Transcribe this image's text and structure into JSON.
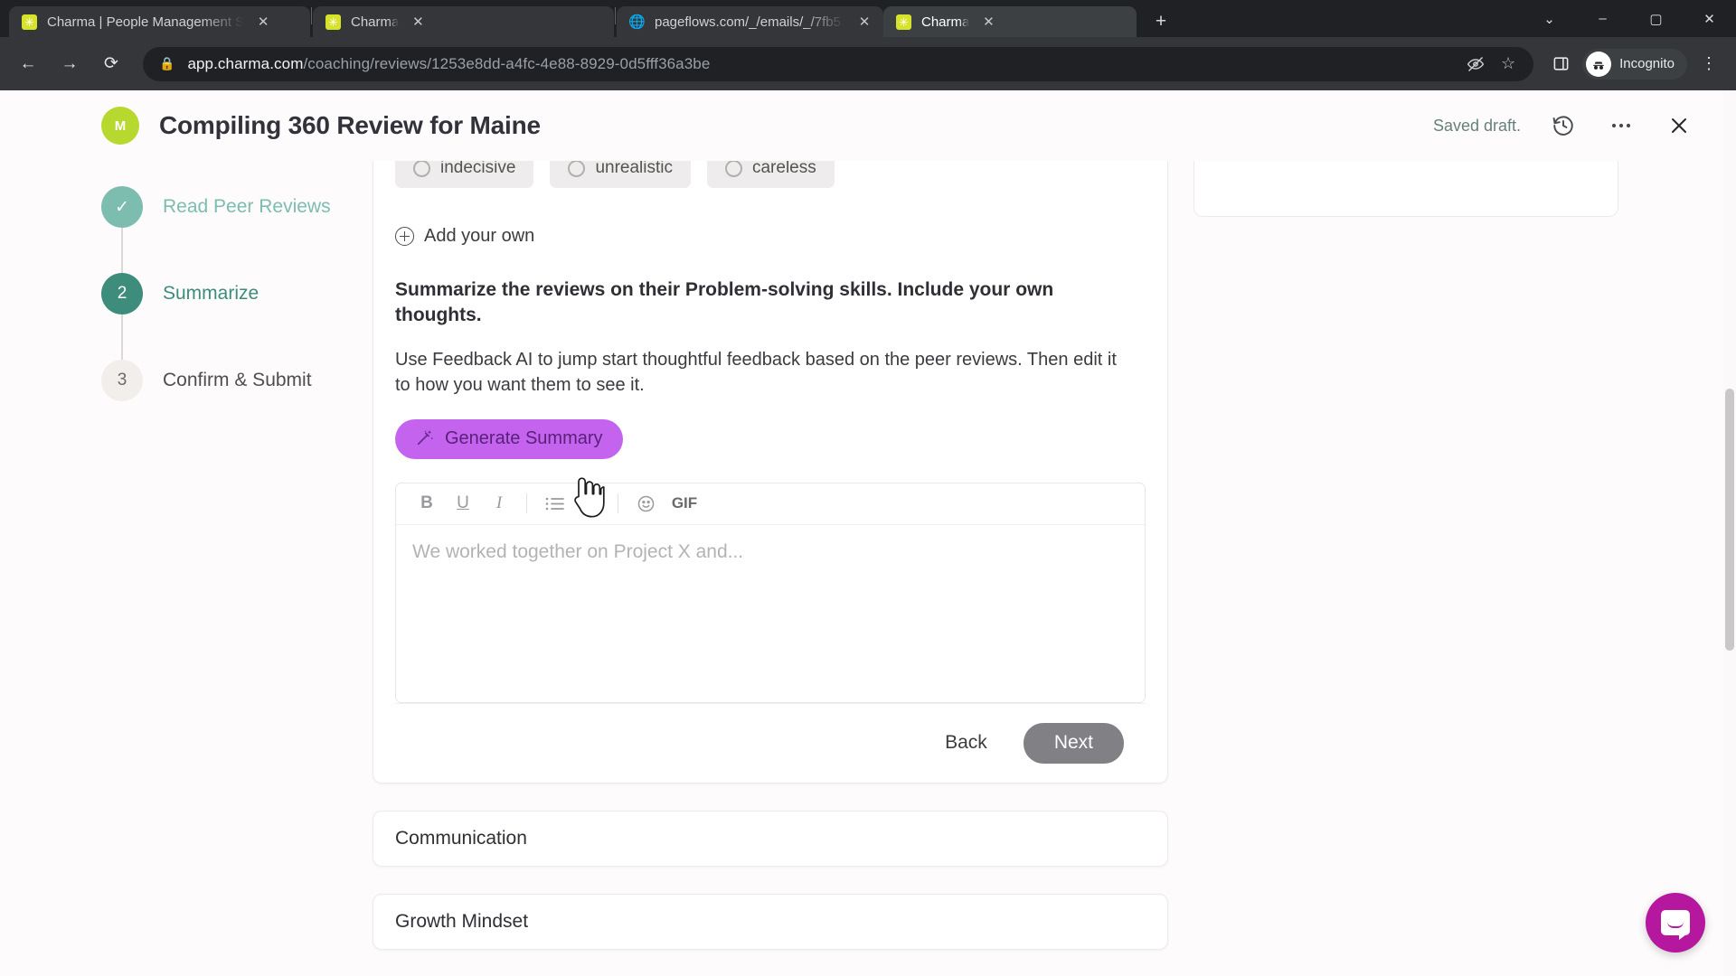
{
  "browser": {
    "tabs": [
      {
        "title": "Charma | People Management S",
        "favicon": "charma-icon",
        "active": false
      },
      {
        "title": "Charma",
        "favicon": "charma-icon",
        "active": false
      },
      {
        "title": "pageflows.com/_/emails/_/7fb5…",
        "favicon": "globe-icon",
        "active": false
      },
      {
        "title": "Charma",
        "favicon": "charma-icon",
        "active": true
      }
    ],
    "new_tab_label": "+",
    "window_controls": {
      "minimize": "–",
      "maximize": "▢",
      "close": "✕",
      "tab_search": "⌄"
    },
    "nav": {
      "back": "←",
      "forward": "→",
      "reload": "⟳"
    },
    "omnibox": {
      "lock_icon": "lock-icon",
      "url_domain": "app.charma.com",
      "url_path": "/coaching/reviews/1253e8dd-a4fc-4e88-8929-0d5fff36a3be",
      "third_party_cookies_icon": "eye-slash-icon",
      "bookmark_icon": "star-icon"
    },
    "side_panel_icon": "side-panel-icon",
    "profile": {
      "label": "Incognito",
      "icon": "incognito-icon"
    },
    "menu_icon": "three-dot-menu-icon"
  },
  "header": {
    "avatar_initial": "M",
    "title": "Compiling 360 Review for Maine",
    "status": "Saved draft.",
    "history_icon": "history-clock-icon",
    "more_icon": "more-horizontal-icon",
    "close_icon": "close-icon"
  },
  "stepper": {
    "steps": [
      {
        "marker": "✓",
        "label": "Read Peer Reviews",
        "state": "done"
      },
      {
        "marker": "2",
        "label": "Summarize",
        "state": "active"
      },
      {
        "marker": "3",
        "label": "Confirm & Submit",
        "state": "todo"
      }
    ]
  },
  "main": {
    "chips": [
      {
        "label": "indecisive"
      },
      {
        "label": "unrealistic"
      },
      {
        "label": "careless"
      }
    ],
    "add_your_own": "Add your own",
    "prompt": "Summarize the reviews on their Problem-solving skills. Include your own thoughts.",
    "subprompt": "Use Feedback AI to jump start thoughtful feedback based on the peer reviews. Then edit it to how you want them to see it.",
    "generate_button": "Generate Summary",
    "generate_icon": "magic-wand-icon",
    "editor": {
      "toolbar": [
        {
          "name": "bold",
          "glyph": "B"
        },
        {
          "name": "underline",
          "glyph": "U"
        },
        {
          "name": "italic",
          "glyph": "I"
        },
        {
          "name": "bullet-list",
          "glyph": "☰"
        },
        {
          "name": "numbered-list",
          "glyph": "☲"
        },
        {
          "name": "emoji",
          "glyph": "☺"
        },
        {
          "name": "gif",
          "glyph": "GIF"
        }
      ],
      "placeholder": "We worked together on Project X and...",
      "value": ""
    },
    "back_button": "Back",
    "next_button": "Next",
    "collapsed_sections": [
      {
        "label": "Communication"
      },
      {
        "label": "Growth Mindset"
      }
    ]
  },
  "widgets": {
    "intercom_label": "intercom-launcher"
  },
  "colors": {
    "accent_green": "#3d8c7c",
    "accent_light_green": "#7cbdb0",
    "avatar_green": "#b7d82e",
    "generate_purple": "#c464ee",
    "next_gray": "#808085",
    "intercom_magenta": "#b5179e"
  }
}
